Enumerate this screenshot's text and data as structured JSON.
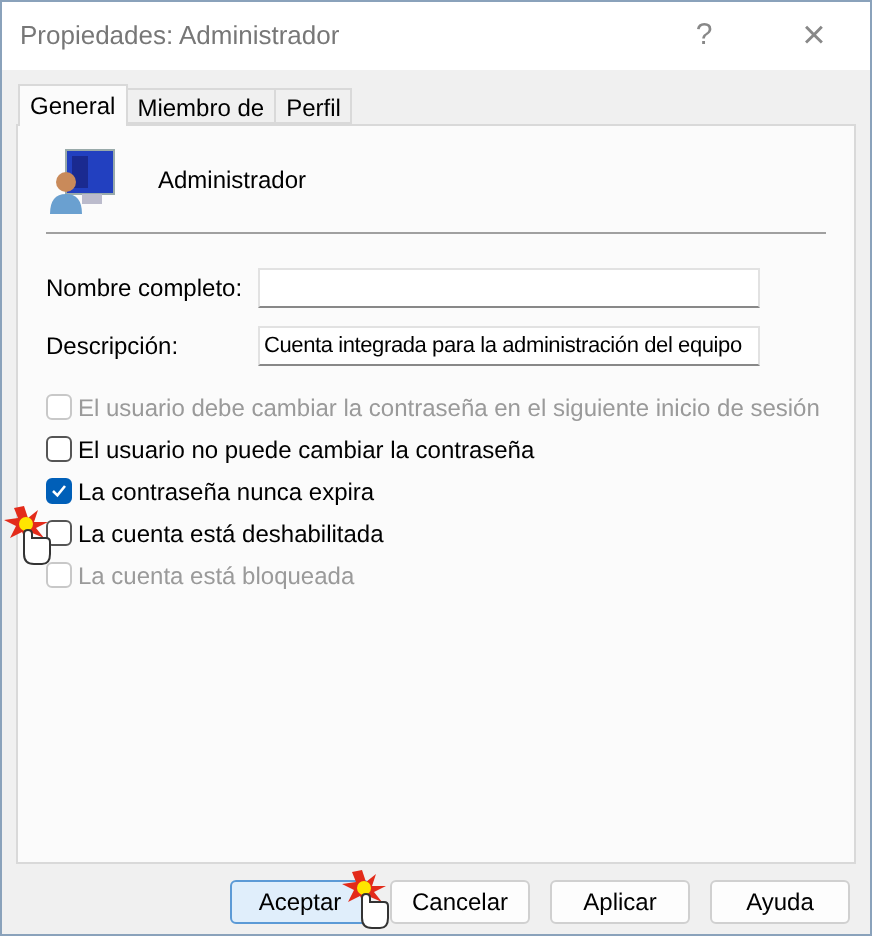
{
  "window": {
    "title": "Propiedades: Administrador",
    "help": "?",
    "close": "×"
  },
  "tabs": [
    {
      "label": "General",
      "selected": true
    },
    {
      "label": "Miembro de",
      "selected": false
    },
    {
      "label": "Perfil",
      "selected": false
    }
  ],
  "user": {
    "name": "Administrador"
  },
  "fields": [
    {
      "label": "Nombre completo:"
    },
    {
      "label": "Descripción:",
      "value": "Cuenta integrada para la administración del equipo"
    }
  ],
  "options": [
    {
      "label": "El usuario debe cambiar la contraseña en el siguiente inicio de sesión",
      "checked": false,
      "disabled": true,
      "clicked": false
    },
    {
      "label": "El usuario no puede cambiar la contraseña",
      "checked": false,
      "disabled": false,
      "clicked": false
    },
    {
      "label": "La contraseña nunca expira",
      "checked": true,
      "disabled": false,
      "clicked": false
    },
    {
      "label": "La cuenta está deshabilitada",
      "checked": false,
      "disabled": false,
      "clicked": true
    },
    {
      "label": "La cuenta está bloqueada",
      "checked": false,
      "disabled": true,
      "clicked": false
    }
  ],
  "buttons": [
    {
      "label": "Aceptar",
      "default": true,
      "clicked": true
    },
    {
      "label": "Cancelar",
      "default": false,
      "clicked": false
    },
    {
      "label": "Aplicar",
      "default": false,
      "clicked": false
    },
    {
      "label": "Ayuda",
      "default": false,
      "clicked": false
    }
  ]
}
